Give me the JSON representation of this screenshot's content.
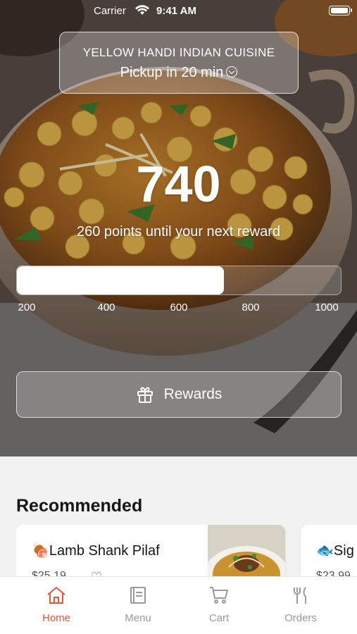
{
  "status_bar": {
    "carrier": "Carrier",
    "time": "9:41 AM"
  },
  "store": {
    "name": "YELLOW HANDI INDIAN CUISINE",
    "pickup": "Pickup in 20 min"
  },
  "rewards": {
    "points": "740",
    "subtitle": "260 points until your next reward",
    "progress_fraction": 0.64,
    "ticks": [
      "200",
      "400",
      "600",
      "800",
      "1000"
    ],
    "button_label": "Rewards"
  },
  "recommended": {
    "title": "Recommended",
    "items": [
      {
        "emoji": "🍖",
        "name": "Lamb Shank Pilaf",
        "price": "$25.19"
      },
      {
        "emoji": "🐟",
        "name": "Sig",
        "price": "$23.99"
      }
    ]
  },
  "tabs": [
    {
      "label": "Home",
      "icon": "home-icon",
      "active": true
    },
    {
      "label": "Menu",
      "icon": "menu-book-icon",
      "active": false
    },
    {
      "label": "Cart",
      "icon": "cart-icon",
      "active": false
    },
    {
      "label": "Orders",
      "icon": "fork-knife-icon",
      "active": false
    }
  ],
  "colors": {
    "accent": "#e8533a",
    "tab_inactive": "#9a9a9a"
  }
}
